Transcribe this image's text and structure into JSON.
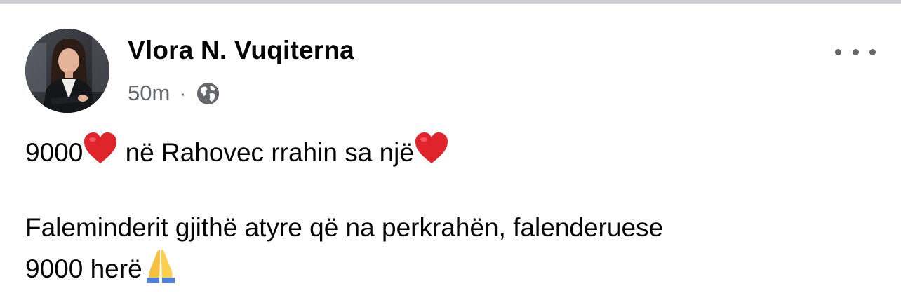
{
  "author": {
    "name": "Vlora N. Vuqiterna"
  },
  "meta": {
    "time": "50m",
    "separator": "·",
    "audience_icon": "globe-icon"
  },
  "menu": {
    "icon": "more-options-icon"
  },
  "post": {
    "line1_a": "9000",
    "line1_b": " në Rahovec rrahin sa një",
    "line2": "   Faleminderit gjithë atyre që na perkrahën, falenderuese",
    "line3": "9000 herë",
    "emojis": [
      "heart-emoji",
      "heart-emoji",
      "folded-hands-emoji"
    ]
  },
  "colors": {
    "text_primary": "#050505",
    "text_secondary": "#65676b",
    "heart": "#e0242b",
    "divider": "#d0d1d5"
  }
}
